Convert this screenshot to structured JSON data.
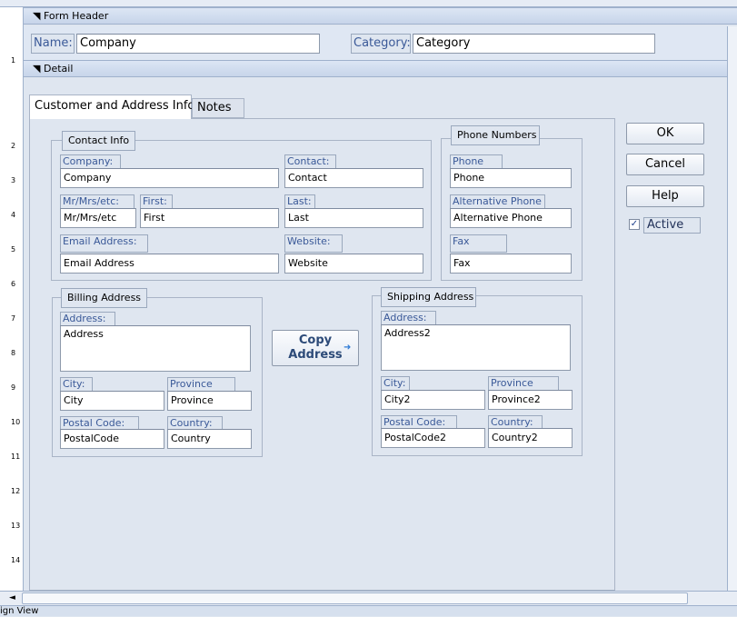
{
  "sections": {
    "form_header": "Form Header",
    "detail": "Detail"
  },
  "form_header": {
    "name_label": "Name:",
    "name_value": "Company",
    "category_label": "Category:",
    "category_value": "Category"
  },
  "tabs": [
    "Customer and Address Info",
    "Notes"
  ],
  "contact_info": {
    "title": "Contact Info",
    "company_label": "Company:",
    "company_value": "Company",
    "contact_label": "Contact:",
    "contact_value": "Contact",
    "title_label": "Mr/Mrs/etc:",
    "title_value": "Mr/Mrs/etc",
    "first_label": "First:",
    "first_value": "First",
    "last_label": "Last:",
    "last_value": "Last",
    "email_label": "Email Address:",
    "email_value": "Email Address",
    "website_label": "Website:",
    "website_value": "Website"
  },
  "phone_numbers": {
    "title": "Phone Numbers",
    "phone_label": "Phone",
    "phone_value": "Phone",
    "alt_label": "Alternative Phone",
    "alt_value": "Alternative Phone",
    "fax_label": "Fax",
    "fax_value": "Fax"
  },
  "billing": {
    "title": "Billing Address",
    "address_label": "Address:",
    "address_value": "Address",
    "city_label": "City:",
    "city_value": "City",
    "province_label": "Province",
    "province_value": "Province",
    "postal_label": "Postal Code:",
    "postal_value": "PostalCode",
    "country_label": "Country:",
    "country_value": "Country"
  },
  "shipping": {
    "title": "Shipping Address",
    "address_label": "Address:",
    "address_value": "Address2",
    "city_label": "City:",
    "city_value": "City2",
    "province_label": "Province",
    "province_value": "Province2",
    "postal_label": "Postal Code:",
    "postal_value": "PostalCode2",
    "country_label": "Country:",
    "country_value": "Country2"
  },
  "copy_button": [
    "Copy",
    "Address"
  ],
  "buttons": {
    "ok": "OK",
    "cancel": "Cancel",
    "help": "Help"
  },
  "active": {
    "label": "Active",
    "checked": true,
    "mark": "✓"
  },
  "ruler": [
    "1",
    "2",
    "3",
    "4",
    "5",
    "6",
    "7",
    "8",
    "9",
    "10",
    "11",
    "12",
    "13",
    "14"
  ],
  "status_text": "ign View",
  "icons": {
    "section_arrow": "section-collapse-icon",
    "copy_arrow": "arrow-right-icon"
  }
}
